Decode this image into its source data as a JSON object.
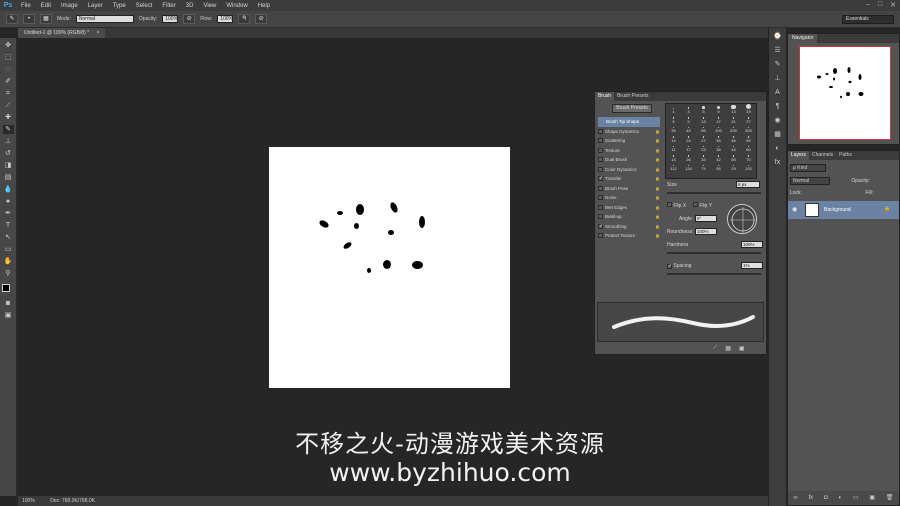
{
  "app": {
    "logo": "Ps"
  },
  "menu": [
    "File",
    "Edit",
    "Image",
    "Layer",
    "Type",
    "Select",
    "Filter",
    "3D",
    "View",
    "Window",
    "Help"
  ],
  "window_controls": [
    "–",
    "□",
    "✕"
  ],
  "options": {
    "mode_label": "Mode:",
    "mode_value": "Normal",
    "opacity_label": "Opacity:",
    "opacity_value": "100%",
    "flow_label": "Flow:",
    "flow_value": "100%",
    "workspace": "Essentials"
  },
  "document": {
    "tab_title": "Untitled-1 @ 100% (RGB/8) *",
    "close": "×"
  },
  "status": {
    "zoom": "100%",
    "doc_info": "Doc: 768.0K/768.0K"
  },
  "brush_panel": {
    "tabs": [
      "Brush",
      "Brush Presets"
    ],
    "presets_button": "Brush Presets",
    "items": [
      {
        "label": "Brush Tip Shape",
        "checked": false,
        "selected": true,
        "checkbox": false
      },
      {
        "label": "Shape Dynamics",
        "checked": false
      },
      {
        "label": "Scattering",
        "checked": false
      },
      {
        "label": "Texture",
        "checked": false
      },
      {
        "label": "Dual Brush",
        "checked": false
      },
      {
        "label": "Color Dynamics",
        "checked": false
      },
      {
        "label": "Transfer",
        "checked": true
      },
      {
        "label": "Brush Pose",
        "checked": false
      },
      {
        "label": "Noise",
        "checked": false
      },
      {
        "label": "Wet Edges",
        "checked": false
      },
      {
        "label": "Build-up",
        "checked": false
      },
      {
        "label": "Smoothing",
        "checked": true
      },
      {
        "label": "Protect Texture",
        "checked": false
      }
    ],
    "tip_sizes": [
      [
        "1",
        "3",
        "5",
        "9",
        "13",
        "19"
      ],
      [
        "5",
        "9",
        "13",
        "17",
        "21",
        "27"
      ],
      [
        "35",
        "45",
        "65",
        "100",
        "200",
        "300"
      ],
      [
        "14",
        "24",
        "27",
        "39",
        "46",
        "59"
      ],
      [
        "11",
        "17",
        "23",
        "36",
        "44",
        "60"
      ],
      [
        "14",
        "26",
        "33",
        "42",
        "55",
        "70"
      ],
      [
        "112",
        "134",
        "74",
        "95",
        "29",
        "192"
      ]
    ],
    "size_label": "Size",
    "size_value": "8 px",
    "flip_x": "Flip X",
    "flip_y": "Flip Y",
    "angle_label": "Angle:",
    "angle_value": "0°",
    "roundness_label": "Roundness:",
    "roundness_value": "100%",
    "hardness_label": "Hardness",
    "hardness_value": "100%",
    "spacing_label": "Spacing",
    "spacing_value": "1%"
  },
  "navigator": {
    "tab": "Navigator"
  },
  "layers": {
    "tabs": [
      "Layers",
      "Channels",
      "Paths"
    ],
    "kind_label": "ρ Kind",
    "blend": "Normal",
    "opacity_label": "Opacity:",
    "lock_label": "Lock:",
    "fill_label": "Fill:",
    "layer_name": "Background"
  },
  "watermark": {
    "line1": "不移之火-动漫游戏美术资源",
    "line2": "www.byzhihuo.com"
  }
}
